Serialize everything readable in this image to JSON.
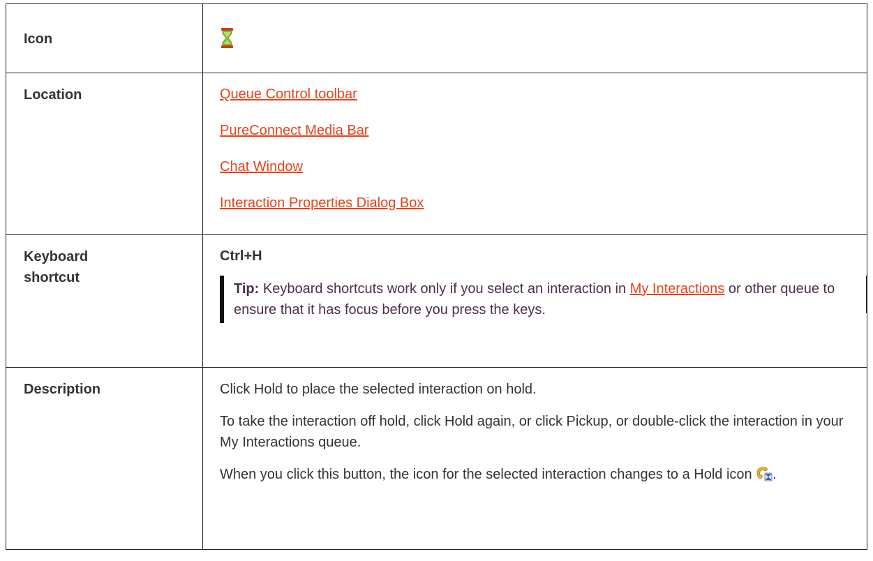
{
  "rows": {
    "icon": {
      "label": "Icon",
      "icon_name": "hourglass-icon"
    },
    "location": {
      "label": "Location",
      "links": [
        "Queue Control toolbar",
        "PureConnect Media Bar",
        "Chat Window",
        "Interaction Properties Dialog Box"
      ]
    },
    "keyboard": {
      "label_line1": "Keyboard",
      "label_line2": "shortcut",
      "shortcut": "Ctrl+H",
      "tip_label": "Tip:",
      "tip_text_before": "Keyboard shortcuts work only if you select an interaction in",
      "tip_link": "My Interactions",
      "tip_text_after": "or other queue to ensure that it has focus before you press the keys."
    },
    "description": {
      "label": "Description",
      "p1": "Click Hold to place the selected interaction on hold.",
      "p2": "To take the interaction off hold, click Hold again, or click Pickup, or double-click the interaction in your My Interactions queue.",
      "p3": "When you click this button, the icon for the selected interaction changes to a Hold icon",
      "p3_end": ".",
      "p3_icon_name": "hold-phone-icon"
    }
  },
  "colors": {
    "link": "#e8431b",
    "tip_text": "#4d2e4d",
    "border": "#222222"
  }
}
